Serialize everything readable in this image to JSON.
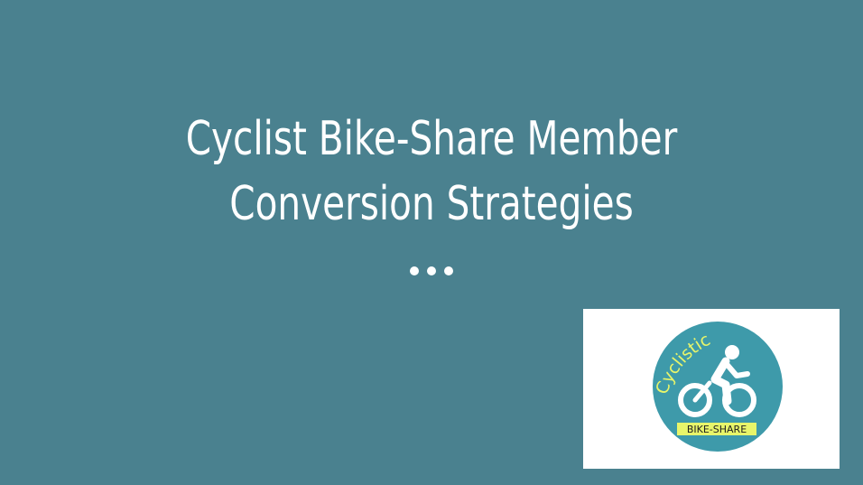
{
  "slide": {
    "title_line1": "Cyclist Bike-Share Member",
    "title_line2": "Conversion Strategies",
    "logo": {
      "brand": "Cyclistic",
      "sub": "BIKE-SHARE",
      "icon": "cyclist-icon"
    }
  },
  "colors": {
    "background": "#4A818F",
    "title_text": "#FFFFFF",
    "logo_circle": "#3E9AAA",
    "logo_wordmark": "#E8F56A",
    "logo_banner": "#E8F56A"
  }
}
